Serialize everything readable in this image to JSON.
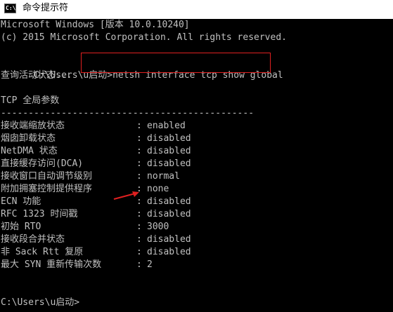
{
  "window": {
    "title": "命令提示符",
    "icon": "cmd-icon",
    "icon_glyph": "C:\\"
  },
  "console": {
    "banner1": "Microsoft Windows [版本 10.0.10240]",
    "banner2": "(c) 2015 Microsoft Corporation. All rights reserved.",
    "prompt1": "C:\\Users\\u启动>",
    "command": "netsh interface tcp show global",
    "status": "查询活动状态...",
    "section_title": "TCP 全局参数",
    "separator": "----------------------------------------------",
    "params": [
      {
        "name": "接收端缩放状态",
        "value": "enabled"
      },
      {
        "name": "烟囱卸载状态",
        "value": "disabled"
      },
      {
        "name": "NetDMA 状态",
        "value": "disabled"
      },
      {
        "name": "直接缓存访问(DCA)",
        "value": "disabled"
      },
      {
        "name": "接收窗口自动调节级别",
        "value": "normal"
      },
      {
        "name": "附加拥塞控制提供程序",
        "value": "none"
      },
      {
        "name": "ECN 功能",
        "value": "disabled"
      },
      {
        "name": "RFC 1323 时间戳",
        "value": "disabled"
      },
      {
        "name": "初始 RTO",
        "value": "3000"
      },
      {
        "name": "接收段合并状态",
        "value": "disabled"
      },
      {
        "name": "非 Sack Rtt 复原",
        "value": "disabled"
      },
      {
        "name": "最大 SYN 重新传输次数",
        "value": "2"
      }
    ],
    "param_colon": ":",
    "prompt2": "C:\\Users\\u启动>"
  },
  "colors": {
    "console_bg": "#000000",
    "console_text": "#c0c0c0",
    "highlight": "#e02020"
  }
}
